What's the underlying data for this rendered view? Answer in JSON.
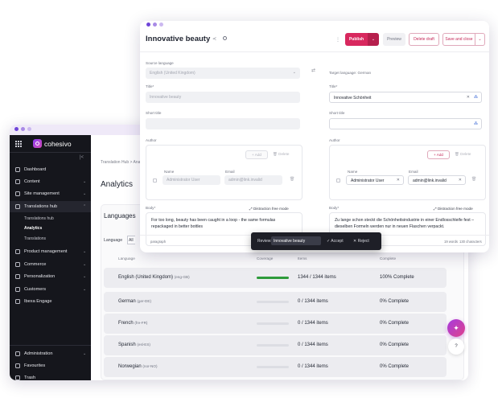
{
  "admin": {
    "brand": "cohesivo",
    "nav": [
      {
        "label": "Dashboard",
        "chevron": ""
      },
      {
        "label": "Content",
        "chevron": "⌄"
      },
      {
        "label": "Site management",
        "chevron": "⌄"
      },
      {
        "label": "Translations hub",
        "chevron": "⌃"
      },
      {
        "label": "Product management",
        "chevron": "⌄"
      },
      {
        "label": "Commerce",
        "chevron": "⌄"
      },
      {
        "label": "Personalization",
        "chevron": "⌄"
      },
      {
        "label": "Customers",
        "chevron": "⌄"
      },
      {
        "label": "Ibexa Engage",
        "chevron": ""
      }
    ],
    "subnav": [
      "Translations hub",
      "Analytics",
      "Translations"
    ],
    "bottom_nav": [
      {
        "label": "Administration",
        "chevron": "⌄"
      },
      {
        "label": "Favourites",
        "chevron": ""
      },
      {
        "label": "Trash",
        "chevron": ""
      }
    ],
    "breadcrumb": "Translation Hub  >  Ana",
    "page_title": "Analytics",
    "section_title": "Languages",
    "language_select_label": "Language",
    "language_select_value": "All",
    "columns": [
      "Language",
      "Coverage",
      "Items",
      "Complete"
    ],
    "rows": [
      {
        "language": "English (United Kingdom)",
        "code": "(eng-GB)",
        "coverage": 1.0,
        "items": "1344 / 1344 items",
        "complete": "100% Complete"
      },
      {
        "language": "German",
        "code": "(ger-DE)",
        "coverage": 0,
        "items": "0 / 1344 items",
        "complete": "0% Complete"
      },
      {
        "language": "French",
        "code": "(fre-FR)",
        "coverage": 0,
        "items": "0 / 1344 items",
        "complete": "0% Complete"
      },
      {
        "language": "Spanish",
        "code": "(esl-ES)",
        "coverage": 0,
        "items": "0 / 1344 items",
        "complete": "0% Complete"
      },
      {
        "language": "Norwegian",
        "code": "(nor-NO)",
        "coverage": 0,
        "items": "0 / 1344 items",
        "complete": "0% Complete"
      }
    ]
  },
  "editor": {
    "title": "Innovative beauty",
    "publish_label": "Publish",
    "preview_label": "Preview",
    "delete_draft_label": "Delete draft",
    "save_close_label": "Save and close",
    "source_language_label": "Source language",
    "source_language_value": "English (United Kingdom)",
    "target_language_label": "Target language: German",
    "title_label": "Title*",
    "source_title": "Innovative beauty",
    "target_title": "Innovative Schönheit",
    "short_title_label": "Short title",
    "author_label": "Author",
    "add_label": "+ Add",
    "delete_label": "Delete",
    "name_label": "Name",
    "email_label": "Email",
    "author_name": "Administrator User",
    "author_email": "admin@link.invalid",
    "body_label": "Body*",
    "distraction_free": "Distraction free mode",
    "source_body": "For too long, beauty has been caught in a loop - the same formulas repackaged in better bottles",
    "target_body": "Zu lange schon steckt die Schönheitsindustrie in einer Endlosschleife fest – dieselben Formeln werden nur in neuen Flaschen verpackt.",
    "toolbar_style": "paragraph",
    "word_count": "19 words",
    "char_count": "130 characters"
  },
  "review": {
    "label": "Review:",
    "value": "Innovative beauty",
    "accept_label": "✓  Accept",
    "reject_label": "✕  Reject"
  },
  "help_label": "?"
}
